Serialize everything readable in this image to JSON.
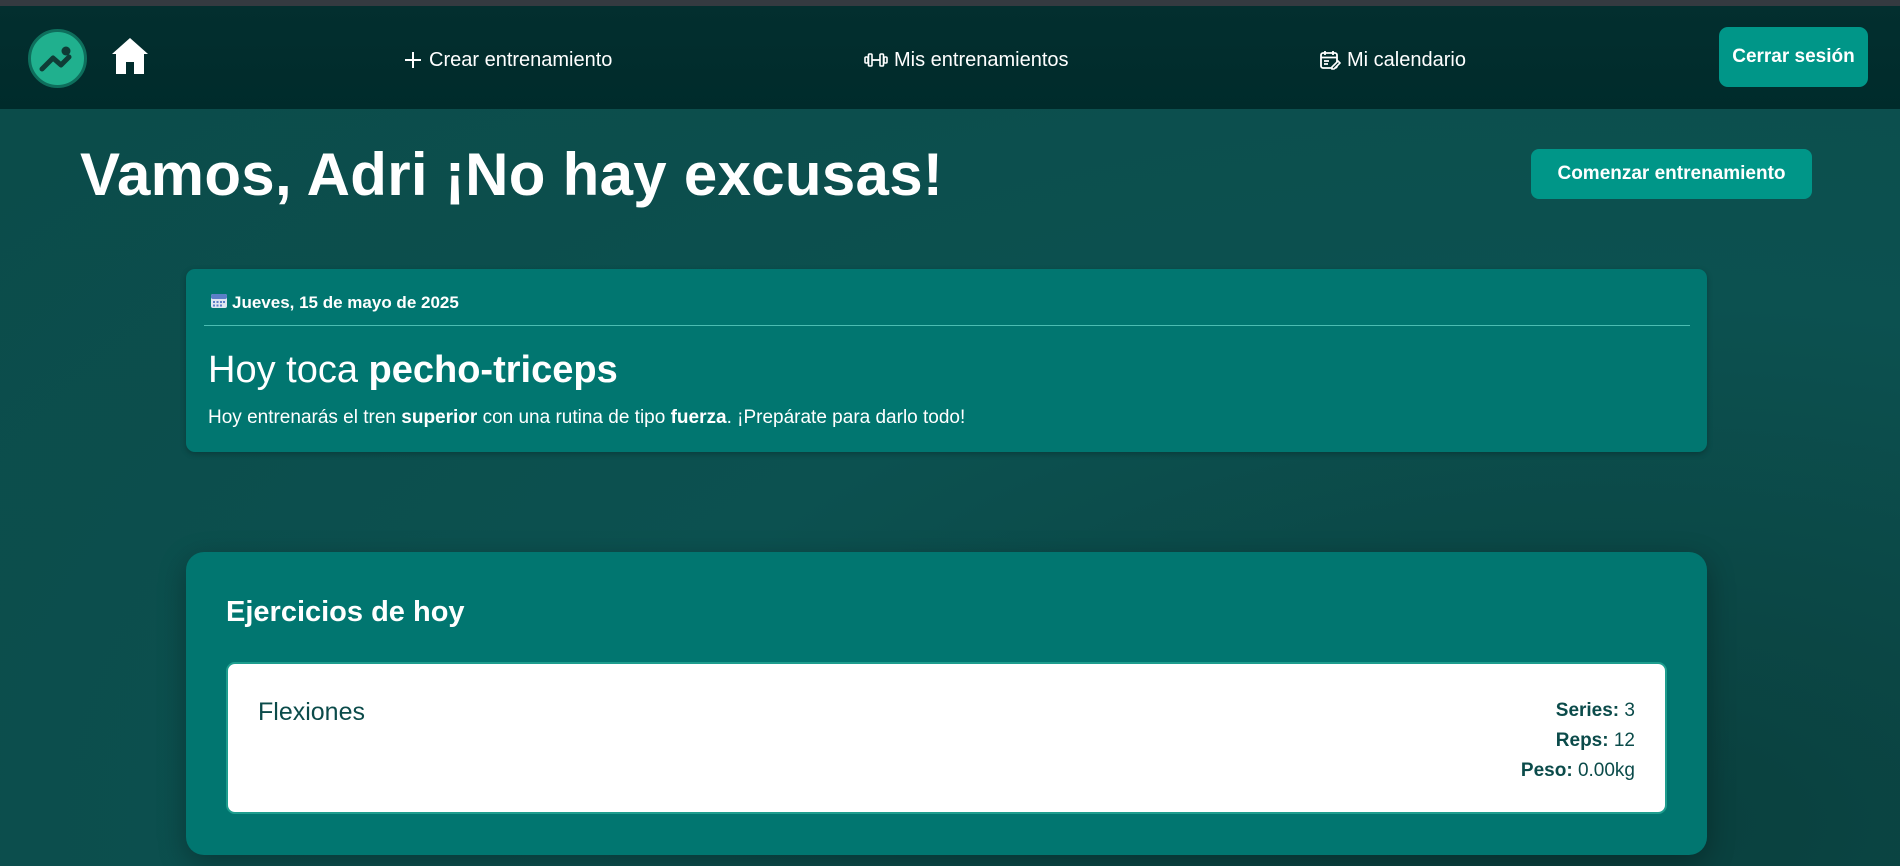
{
  "nav": {
    "create_label": "Crear entrenamiento",
    "my_workouts_label": "Mis entrenamientos",
    "calendar_label": "Mi calendario",
    "logout_label": "Cerrar sesión"
  },
  "header": {
    "title": "Vamos, Adri ¡No hay excusas!",
    "start_button_label": "Comenzar entrenamiento"
  },
  "today": {
    "date": "Jueves, 15 de mayo de 2025",
    "heading_prefix": "Hoy toca ",
    "routine_name": "pecho-triceps",
    "desc_part1": "Hoy entrenarás el tren ",
    "body_part": "superior",
    "desc_part2": " con una rutina de tipo ",
    "routine_type": "fuerza",
    "desc_part3": ". ¡Prepárate para darlo todo!"
  },
  "exercises": {
    "section_title": "Ejercicios de hoy",
    "items": [
      {
        "name": "Flexiones",
        "series_label": "Series:",
        "series_value": "3",
        "reps_label": "Reps:",
        "reps_value": "12",
        "weight_label": "Peso:",
        "weight_value": "0.00",
        "weight_unit": "kg"
      }
    ]
  },
  "colors": {
    "accent": "#009688",
    "navbar": "#002b2b",
    "card": "#017670",
    "background": "#0c4f4d"
  },
  "icons": {
    "logo": "app-logo-icon",
    "home": "home-icon",
    "create": "plus-icon",
    "my_workouts": "dumbbell-icon",
    "calendar": "calendar-edit-icon",
    "date": "calendar-icon"
  }
}
